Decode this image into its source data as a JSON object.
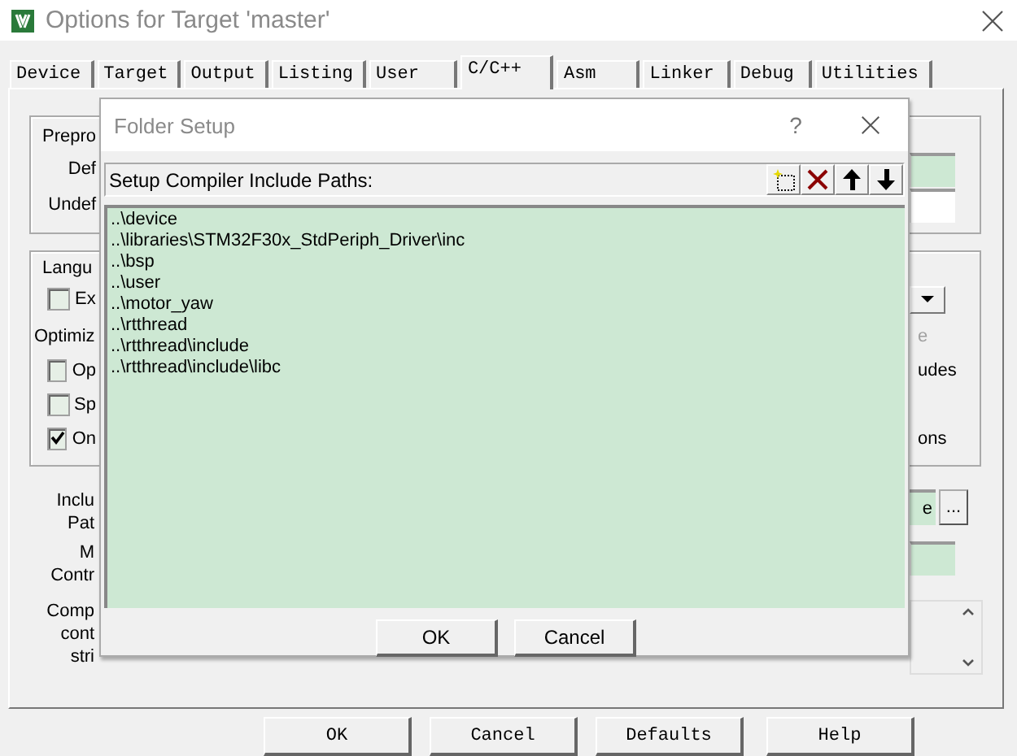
{
  "window": {
    "title": "Options for Target 'master'"
  },
  "tabs": [
    {
      "label": "Device",
      "selected": false
    },
    {
      "label": "Target",
      "selected": false
    },
    {
      "label": "Output",
      "selected": false
    },
    {
      "label": "Listing",
      "selected": false
    },
    {
      "label": "User",
      "selected": false
    },
    {
      "label": "C/C++",
      "selected": true
    },
    {
      "label": "Asm",
      "selected": false
    },
    {
      "label": "Linker",
      "selected": false
    },
    {
      "label": "Debug",
      "selected": false
    },
    {
      "label": "Utilities",
      "selected": false
    }
  ],
  "preprocessor": {
    "group_label": "Prepro",
    "define_label": "Def",
    "undefine_label": "Undef"
  },
  "language": {
    "group_label": "Langu",
    "rows": [
      {
        "kind": "checkbox",
        "label": "Ex",
        "checked": false
      },
      {
        "kind": "heading",
        "label": "Optimiz",
        "right": "e",
        "right_disabled": true
      },
      {
        "kind": "checkbox",
        "label": "Op",
        "checked": false,
        "right": "udes",
        "right_disabled": false
      },
      {
        "kind": "checkbox",
        "label": "Sp",
        "checked": false
      },
      {
        "kind": "checkbox",
        "label": "On",
        "checked": true,
        "right": "ons",
        "right_disabled": false
      }
    ]
  },
  "paths": {
    "include_labels": [
      "Inclu",
      "Pat"
    ],
    "include_value": "e",
    "browse_button": "...",
    "misc_labels": [
      "M",
      "Contr"
    ],
    "compiler_labels": [
      "Comp",
      "cont",
      "stri"
    ]
  },
  "folder_setup": {
    "title": "Folder Setup",
    "help": "?",
    "list_label": "Setup Compiler Include Paths:",
    "paths": [
      "..\\device",
      "..\\libraries\\STM32F30x_StdPeriph_Driver\\inc",
      "..\\bsp",
      "..\\user",
      "..\\motor_yaw",
      "..\\rtthread",
      "..\\rtthread\\include",
      "..\\rtthread\\include\\libc"
    ],
    "buttons": [
      "OK",
      "Cancel"
    ]
  },
  "buttons": [
    "OK",
    "Cancel",
    "Defaults",
    "Help"
  ]
}
